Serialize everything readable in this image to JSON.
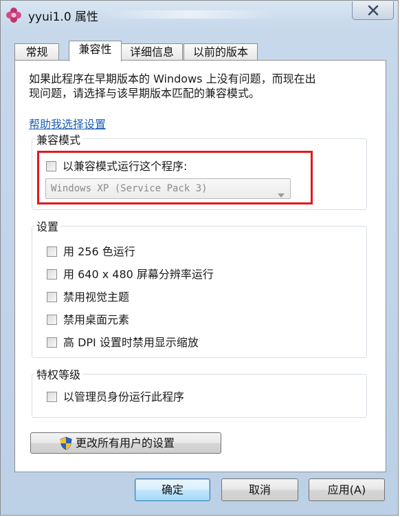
{
  "window": {
    "title": "yyui1.0 属性"
  },
  "tabs": [
    {
      "label": "常规"
    },
    {
      "label": "兼容性"
    },
    {
      "label": "详细信息"
    },
    {
      "label": "以前的版本"
    }
  ],
  "compatibility": {
    "intro_line1": "如果此程序在早期版本的 Windows 上没有问题，而现在出",
    "intro_line2": "现问题，请选择与该早期版本匹配的兼容模式。",
    "help_link": "帮助我选择设置",
    "mode_group": {
      "title": "兼容模式",
      "checkbox_label": "以兼容模式运行这个程序:",
      "checked": false,
      "os_value": "Windows XP (Service Pack 3)"
    },
    "settings_group": {
      "title": "设置",
      "items": [
        {
          "label": "用 256 色运行",
          "checked": false
        },
        {
          "label": "用 640 x 480 屏幕分辨率运行",
          "checked": false
        },
        {
          "label": "禁用视觉主题",
          "checked": false
        },
        {
          "label": "禁用桌面元素",
          "checked": false
        },
        {
          "label": "高 DPI 设置时禁用显示缩放",
          "checked": false
        }
      ]
    },
    "privilege_group": {
      "title": "特权等级",
      "items": [
        {
          "label": "以管理员身份运行此程序",
          "checked": false
        }
      ]
    },
    "all_users_button": "更改所有用户的设置"
  },
  "buttons": {
    "ok": "确定",
    "cancel": "取消",
    "apply": "应用(A)"
  },
  "colors": {
    "highlight_box": "#e5161e",
    "link": "#1c5fb0"
  }
}
